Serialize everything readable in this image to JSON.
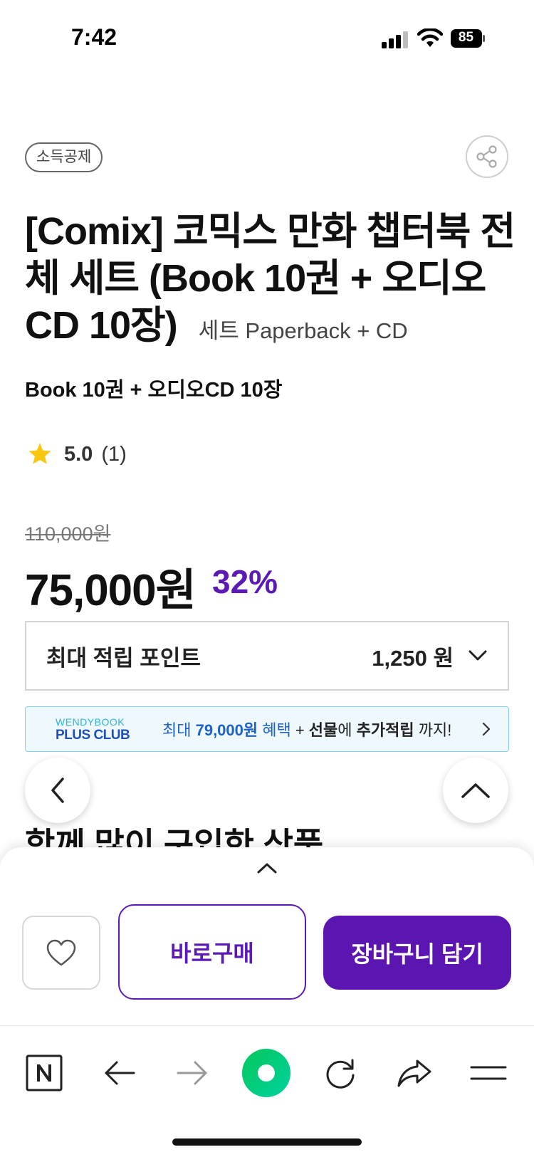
{
  "status_bar": {
    "time": "7:42",
    "battery": "85"
  },
  "product": {
    "badge": "소득공제",
    "title": "[Comix] 코믹스 만화 챕터북 전체 세트 (Book 10권 + 오디오CD 10장)",
    "format": "세트 Paperback + CD",
    "subtitle": "Book 10권 + 오디오CD 10장",
    "rating": {
      "score": "5.0",
      "count": "(1)"
    },
    "original_price": "110,000원",
    "price": "75,000원",
    "discount": "32%"
  },
  "points": {
    "label": "최대 적립 포인트",
    "value": "1,250 원"
  },
  "club_banner": {
    "logo_top": "WENDYBOOK",
    "logo_bottom": "PLUS CLUB",
    "text_part1": "최대 ",
    "text_part2": "79,000원",
    "text_part3": " 혜택",
    "text_part4": " + ",
    "text_part5": "선물",
    "text_part6": "에 ",
    "text_part7": "추가적립",
    "text_part8": " 까지!"
  },
  "section": {
    "title": "함께 많이 구입한 상품"
  },
  "actions": {
    "buy_now": "바로구매",
    "add_to_cart": "장바구니 담기"
  },
  "colors": {
    "accent": "#5b15b0",
    "club_blue": "#1e62c8",
    "star": "#f9c80e",
    "naver_green": "#03c75a"
  }
}
